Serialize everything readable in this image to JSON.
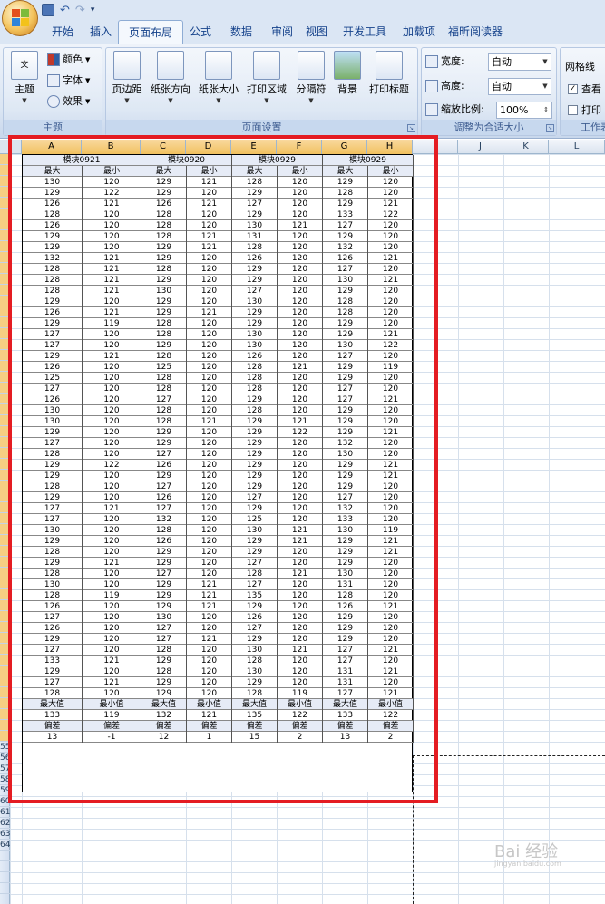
{
  "qat": {
    "save_icon": "save-icon",
    "undo_icon": "undo-icon",
    "redo_icon": "redo-icon"
  },
  "tabs": [
    "开始",
    "插入",
    "页面布局",
    "公式",
    "数据",
    "审阅",
    "视图",
    "开发工具",
    "加载项",
    "福昕阅读器"
  ],
  "active_tab": "页面布局",
  "ribbon": {
    "theme_group": {
      "label": "主题",
      "theme_btn": "主题",
      "colors": "颜色",
      "fonts": "字体",
      "effects": "效果"
    },
    "page_setup_group": {
      "label": "页面设置",
      "margins": "页边距",
      "orientation": "纸张方向",
      "size": "纸张大小",
      "print_area": "打印区域",
      "breaks": "分隔符",
      "background": "背景",
      "print_titles": "打印标题"
    },
    "scale_group": {
      "label": "调整为合适大小",
      "width_label": "宽度:",
      "width_value": "自动",
      "height_label": "高度:",
      "height_value": "自动",
      "scale_label": "缩放比例:",
      "scale_value": "100%"
    },
    "sheet_opts_group": {
      "label": "工作表",
      "gridlines": "网格线",
      "view": "查看",
      "print": "打印"
    }
  },
  "columns": [
    "A",
    "B",
    "C",
    "D",
    "E",
    "F",
    "G",
    "H",
    "I",
    "J",
    "K",
    "L"
  ],
  "header_row": [
    "模块0921",
    "模块0920",
    "模块0929",
    "模块0929"
  ],
  "subheader": [
    "最大",
    "最小",
    "最大",
    "最小",
    "最大",
    "最小",
    "最大",
    "最小"
  ],
  "rows": [
    [
      "130",
      "120",
      "129",
      "121",
      "128",
      "120",
      "129",
      "120"
    ],
    [
      "129",
      "122",
      "129",
      "120",
      "129",
      "120",
      "128",
      "120"
    ],
    [
      "126",
      "121",
      "126",
      "121",
      "127",
      "120",
      "129",
      "121"
    ],
    [
      "128",
      "120",
      "128",
      "120",
      "129",
      "120",
      "133",
      "122"
    ],
    [
      "126",
      "120",
      "128",
      "120",
      "130",
      "121",
      "127",
      "120"
    ],
    [
      "129",
      "120",
      "128",
      "121",
      "131",
      "120",
      "129",
      "120"
    ],
    [
      "129",
      "120",
      "129",
      "121",
      "128",
      "120",
      "132",
      "120"
    ],
    [
      "132",
      "121",
      "129",
      "120",
      "126",
      "120",
      "126",
      "121"
    ],
    [
      "128",
      "121",
      "128",
      "120",
      "129",
      "120",
      "127",
      "120"
    ],
    [
      "128",
      "121",
      "129",
      "120",
      "129",
      "120",
      "130",
      "121"
    ],
    [
      "128",
      "121",
      "130",
      "120",
      "127",
      "120",
      "129",
      "120"
    ],
    [
      "129",
      "120",
      "129",
      "120",
      "130",
      "120",
      "128",
      "120"
    ],
    [
      "126",
      "121",
      "129",
      "121",
      "129",
      "120",
      "128",
      "120"
    ],
    [
      "129",
      "119",
      "128",
      "120",
      "129",
      "120",
      "129",
      "120"
    ],
    [
      "127",
      "120",
      "128",
      "120",
      "130",
      "120",
      "129",
      "121"
    ],
    [
      "127",
      "120",
      "129",
      "120",
      "130",
      "120",
      "130",
      "122"
    ],
    [
      "129",
      "121",
      "128",
      "120",
      "126",
      "120",
      "127",
      "120"
    ],
    [
      "126",
      "120",
      "125",
      "120",
      "128",
      "121",
      "129",
      "119"
    ],
    [
      "125",
      "120",
      "128",
      "120",
      "128",
      "120",
      "129",
      "120"
    ],
    [
      "127",
      "120",
      "128",
      "120",
      "128",
      "120",
      "127",
      "120"
    ],
    [
      "126",
      "120",
      "127",
      "120",
      "129",
      "120",
      "127",
      "121"
    ],
    [
      "130",
      "120",
      "128",
      "120",
      "128",
      "120",
      "129",
      "120"
    ],
    [
      "130",
      "120",
      "128",
      "121",
      "129",
      "121",
      "129",
      "120"
    ],
    [
      "129",
      "120",
      "129",
      "120",
      "129",
      "122",
      "129",
      "121"
    ],
    [
      "127",
      "120",
      "129",
      "120",
      "129",
      "120",
      "132",
      "120"
    ],
    [
      "128",
      "120",
      "127",
      "120",
      "129",
      "120",
      "130",
      "120"
    ],
    [
      "129",
      "122",
      "126",
      "120",
      "129",
      "120",
      "129",
      "121"
    ],
    [
      "129",
      "120",
      "129",
      "120",
      "129",
      "120",
      "129",
      "121"
    ],
    [
      "128",
      "120",
      "127",
      "120",
      "129",
      "120",
      "129",
      "120"
    ],
    [
      "129",
      "120",
      "126",
      "120",
      "127",
      "120",
      "127",
      "120"
    ],
    [
      "127",
      "121",
      "127",
      "120",
      "129",
      "120",
      "132",
      "120"
    ],
    [
      "127",
      "120",
      "132",
      "120",
      "125",
      "120",
      "133",
      "120"
    ],
    [
      "130",
      "120",
      "128",
      "120",
      "130",
      "121",
      "130",
      "119"
    ],
    [
      "129",
      "120",
      "126",
      "120",
      "129",
      "121",
      "129",
      "121"
    ],
    [
      "128",
      "120",
      "129",
      "120",
      "129",
      "120",
      "129",
      "121"
    ],
    [
      "129",
      "121",
      "129",
      "120",
      "127",
      "120",
      "129",
      "120"
    ],
    [
      "128",
      "120",
      "127",
      "120",
      "128",
      "121",
      "130",
      "120"
    ],
    [
      "130",
      "120",
      "129",
      "121",
      "127",
      "120",
      "131",
      "120"
    ],
    [
      "128",
      "119",
      "129",
      "121",
      "135",
      "120",
      "128",
      "120"
    ],
    [
      "126",
      "120",
      "129",
      "121",
      "129",
      "120",
      "126",
      "121"
    ],
    [
      "127",
      "120",
      "130",
      "120",
      "126",
      "120",
      "129",
      "120"
    ],
    [
      "126",
      "120",
      "127",
      "120",
      "127",
      "120",
      "129",
      "120"
    ],
    [
      "129",
      "120",
      "127",
      "121",
      "129",
      "120",
      "129",
      "120"
    ],
    [
      "127",
      "120",
      "128",
      "120",
      "130",
      "121",
      "127",
      "121"
    ],
    [
      "133",
      "121",
      "129",
      "120",
      "128",
      "120",
      "127",
      "120"
    ],
    [
      "129",
      "120",
      "128",
      "120",
      "130",
      "120",
      "131",
      "121"
    ],
    [
      "127",
      "121",
      "129",
      "120",
      "129",
      "120",
      "131",
      "120"
    ],
    [
      "128",
      "120",
      "129",
      "120",
      "128",
      "119",
      "127",
      "121"
    ]
  ],
  "summary": [
    [
      "最大值",
      "最小值",
      "最大值",
      "最小值",
      "最大值",
      "最小值",
      "最大值",
      "最小值"
    ],
    [
      "133",
      "119",
      "132",
      "121",
      "135",
      "122",
      "133",
      "122"
    ],
    [
      "偏差",
      "偏差",
      "偏差",
      "偏差",
      "偏差",
      "偏差",
      "偏差",
      "偏差"
    ],
    [
      "13",
      "-1",
      "12",
      "1",
      "15",
      "2",
      "13",
      "2"
    ]
  ],
  "row_numbers_tail": [
    "55",
    "56",
    "57",
    "58",
    "59",
    "60",
    "61",
    "62",
    "63",
    "64"
  ],
  "watermark": {
    "text": "Bai 经验",
    "sub": "jingyan.baidu.com"
  }
}
